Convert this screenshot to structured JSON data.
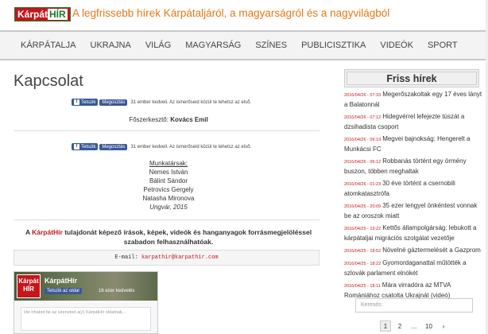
{
  "header": {
    "logo_top": "Kárpát",
    "logo_bottom": "HÍR",
    "tagline": "A legfrissebb hírek Kárpátaljáról, a magyarságról és a nagyvilágból"
  },
  "nav": {
    "items": [
      "KÁRPÁTALJA",
      "UKRAJNA",
      "VILÁG",
      "MAGYARSÁG",
      "SZÍNES",
      "PUBLICISZTIKA",
      "VIDEÓK",
      "SPORT"
    ]
  },
  "main": {
    "title": "Kapcsolat",
    "share": {
      "like_label": "Tetszik",
      "share_label": "Megosztás",
      "count_text": "31 ember kedveli. Az ismerőseid közül te lehetsz az első."
    },
    "editor_label": "Főszerkesztő:",
    "editor_name": "Kovács Emil",
    "staff_heading": "Munkatársak:",
    "staff": [
      "Nemes István",
      "Bálint Sándor",
      "Petrovics Gergely",
      "Natasha Mironova"
    ],
    "place_year": "Ungvár, 2015",
    "copyright_pre": "A ",
    "copyright_brand": "KárpátHír",
    "copyright_post": " tulajdonát képező írások, képek, videók és hanganyagok forrásmegjelöléssel szabadon felhasználhatóak.",
    "email_label": "E-mail:",
    "email_address": "karpathir@karpathir.com"
  },
  "fb_widget": {
    "logo_text": "Kárpát HÍR",
    "page_name": "KárpátHír",
    "like_label": "Tetszik az oldal",
    "count": "16 ezer kedvelés",
    "placeholder": "Ide írhatod be az üzeneted a(z) KárpátHír oldalnak..."
  },
  "sidebar": {
    "title": "Friss hírek",
    "news": [
      {
        "date": "2016/04/26 - 07:33",
        "title": "Megerőszakoltak egy 17 éves lányt a Balatonnál"
      },
      {
        "date": "2016/04/26 - 07:12",
        "title": "Hidegvérrel lefejezte túszát a dzsihadista csoport"
      },
      {
        "date": "2016/04/26 - 06:19",
        "title": "Megvei bajnokság: Hengerelt a Munkácsi FC"
      },
      {
        "date": "2016/04/26 - 06:12",
        "title": "Robbanás történt egy örmény buszon, többen meghaltak"
      },
      {
        "date": "2016/04/26 - 01:23",
        "title": "30 éve történt a csernobili atomkatasztrófa"
      },
      {
        "date": "2016/04/25 - 20:09",
        "title": "35 ezer lengyel önkéntest vonnak be az oroszok miatt"
      },
      {
        "date": "2016/04/25 - 19:22",
        "title": "Kettős állampolgárság: lebukott a kárpátaljai migrációs szolgálat vezetője"
      },
      {
        "date": "2016/04/25 - 18:52",
        "title": "Növelné gáztermelését a Gazprom"
      },
      {
        "date": "2016/04/25 - 18:22",
        "title": "Gyomordaganattal műtötték a szlovák parlament elnökét"
      },
      {
        "date": "2016/04/25 - 18:11",
        "title": "Mára virradóra az MTVA Romániához csatolta Ukrajnát (videó)"
      }
    ],
    "search_placeholder": "Keresés:",
    "pager": [
      "1",
      "2",
      "...",
      "10",
      "›"
    ]
  }
}
